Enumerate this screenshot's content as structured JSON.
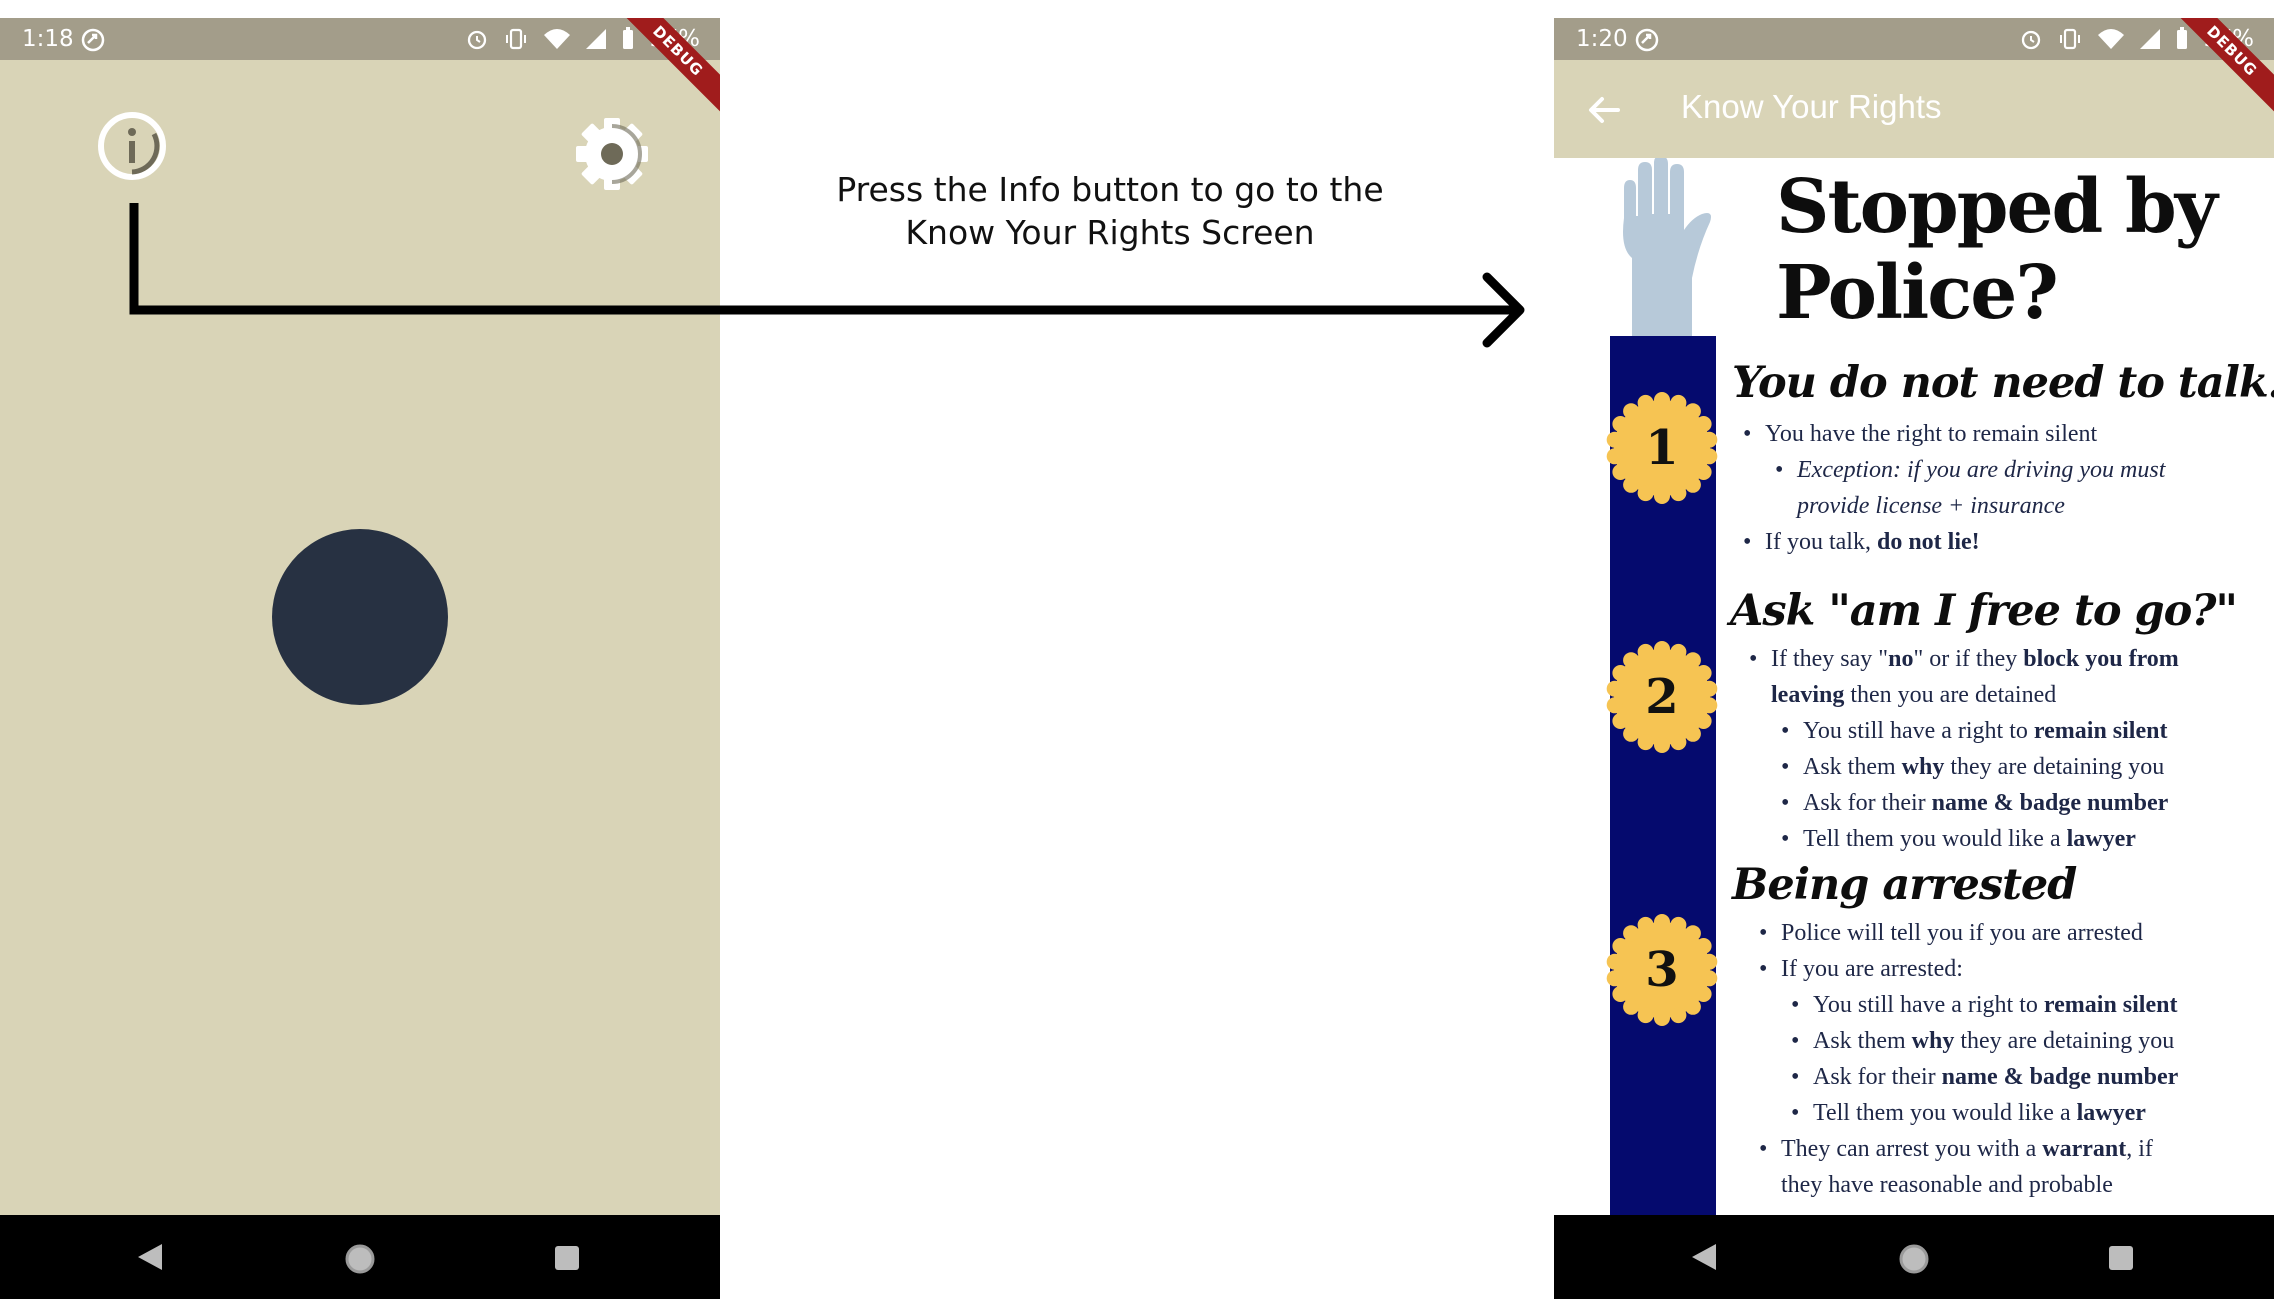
{
  "annotation": {
    "line1": "Press the Info button to go to the",
    "line2": "Know Your Rights Screen"
  },
  "left_screen": {
    "status": {
      "time": "1:18",
      "battery": "97%"
    },
    "debug_label": "DEBUG"
  },
  "right_screen": {
    "status": {
      "time": "1:20",
      "battery": "97%"
    },
    "debug_label": "DEBUG",
    "app_bar": {
      "title": "Know Your Rights"
    },
    "hero": {
      "line1": "Stopped by",
      "line2": "Police?"
    },
    "sections": [
      {
        "number": "1",
        "title": "You do not need to talk!",
        "lines": [
          {
            "pre": "You have the right to remain silent"
          },
          {
            "italic": "Exception: if you are driving you must"
          },
          {
            "italic": "provide license + insurance"
          },
          {
            "pre": "If you talk, ",
            "bold": "do not lie!"
          }
        ]
      },
      {
        "number": "2",
        "title": "Ask \"am I free to go?\"",
        "lines": [
          {
            "pre": "If they say \"",
            "bold": "no",
            "mid": "\" or if they ",
            "bold2": "block you from"
          },
          {
            "bold": "leaving",
            "post": " then you are detained"
          },
          {
            "pre": "You still have a right to ",
            "bold": "remain silent"
          },
          {
            "pre": "Ask them ",
            "bold": "why",
            "post": " they are detaining you"
          },
          {
            "pre": "Ask for their ",
            "bold": "name & badge number"
          },
          {
            "pre": "Tell them you would like a ",
            "bold": "lawyer"
          }
        ]
      },
      {
        "number": "3",
        "title": "Being arrested",
        "lines": [
          {
            "pre": "Police will tell you if you are arrested"
          },
          {
            "pre": "If you are arrested:"
          },
          {
            "pre": "You still have a right to ",
            "bold": "remain silent"
          },
          {
            "pre": "Ask them ",
            "bold": "why",
            "post": " they are detaining you"
          },
          {
            "pre": "Ask for their ",
            "bold": "name & badge number"
          },
          {
            "pre": "Tell them you would like a ",
            "bold": "lawyer"
          },
          {
            "pre": "They can arrest you with a ",
            "bold": "warrant",
            "post": ", if"
          },
          {
            "pre": "they have reasonable and probable"
          }
        ]
      }
    ]
  },
  "icons": {
    "info": "info-icon",
    "settings": "gear-icon",
    "back": "arrow-back-icon",
    "hand": "raised-hand-icon",
    "nav_back": "triangle-back-icon",
    "nav_home": "circle-home-icon",
    "nav_recents": "square-recents-icon"
  },
  "colors": {
    "app_background": "#d9d4b7",
    "status_bar": "#a39d8a",
    "record_button": "#273142",
    "timeline": "#050a6e",
    "badge": "#f6c453",
    "hand": "#b7c9d9",
    "debug_ribbon": "#a01c1c"
  }
}
